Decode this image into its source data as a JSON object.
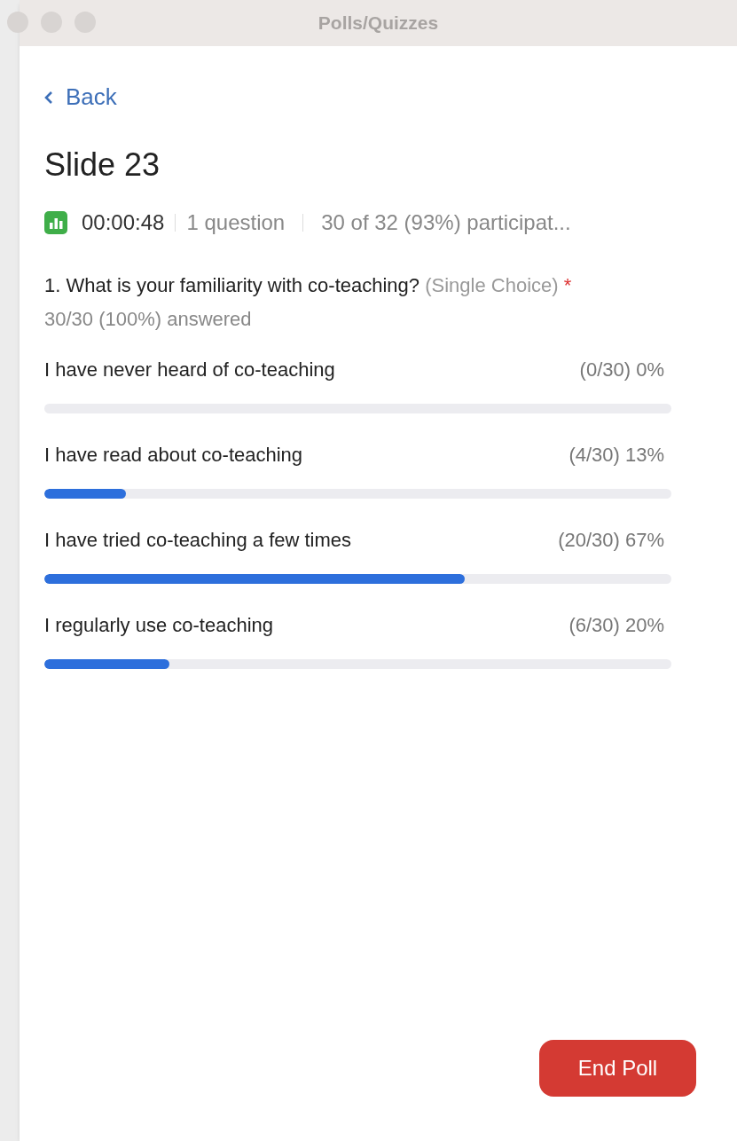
{
  "window": {
    "title": "Polls/Quizzes"
  },
  "back": {
    "label": "Back"
  },
  "title": "Slide 23",
  "meta": {
    "timer": "00:00:48",
    "questions": "1 question",
    "participation": "30 of 32 (93%) participat..."
  },
  "question": {
    "text": "1. What is your familiarity with co-teaching?",
    "type_note": "(Single Choice)",
    "required_mark": "*",
    "answered": "30/30 (100%) answered"
  },
  "options": [
    {
      "label": "I have never heard of co-teaching",
      "result": "(0/30) 0%",
      "level": 0
    },
    {
      "label": "I have read about co-teaching",
      "result": "(4/30) 13%",
      "level": 0.13
    },
    {
      "label": "I have tried co-teaching a few times",
      "result": "(20/30) 67%",
      "level": 0.67
    },
    {
      "label": "I regularly use co-teaching",
      "result": "(6/30) 20%",
      "level": 0.2
    }
  ],
  "end_button": {
    "label": "End Poll"
  }
}
